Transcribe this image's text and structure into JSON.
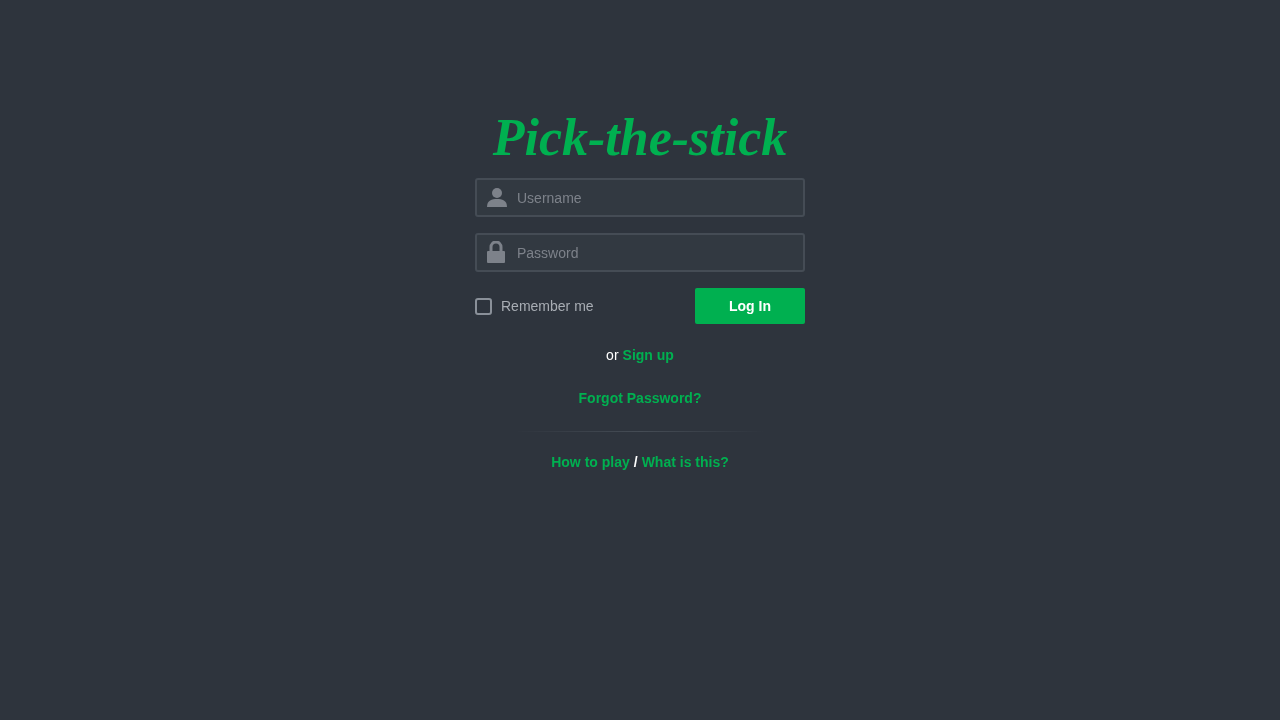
{
  "logo": "Pick-the-stick",
  "fields": [
    {
      "kind": "user",
      "placeholder": "Username"
    },
    {
      "kind": "lock",
      "placeholder": "Password"
    }
  ],
  "remember": {
    "label": "Remember me",
    "checked": false
  },
  "login_button": "Log In",
  "signup": {
    "prefix": "or",
    "link": "Sign up"
  },
  "forgot_link": "Forgot Password?",
  "footer": {
    "links": [
      "How to play",
      "What is this?"
    ],
    "separator": "/"
  }
}
